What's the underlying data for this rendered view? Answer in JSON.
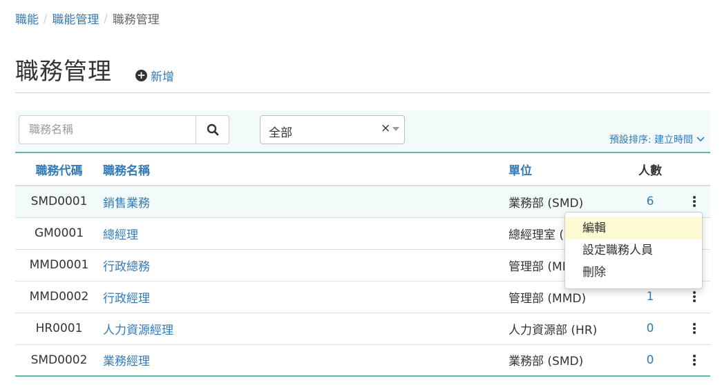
{
  "breadcrumb": {
    "items": [
      "職能",
      "職能管理"
    ],
    "current": "職務管理"
  },
  "page": {
    "title": "職務管理",
    "add_label": "新增"
  },
  "filters": {
    "search_placeholder": "職務名稱",
    "select_value": "全部",
    "sort_label": "預設排序: 建立時間"
  },
  "table": {
    "headers": {
      "code": "職務代碼",
      "name": "職務名稱",
      "unit": "單位",
      "count": "人數"
    },
    "rows": [
      {
        "code": "SMD0001",
        "name": "銷售業務",
        "unit": "業務部 (SMD)",
        "count": "6"
      },
      {
        "code": "GM0001",
        "name": "總經理",
        "unit": "總經理室 (GM)",
        "count": ""
      },
      {
        "code": "MMD0001",
        "name": "行政總務",
        "unit": "管理部 (MMD)",
        "count": ""
      },
      {
        "code": "MMD0002",
        "name": "行政經理",
        "unit": "管理部 (MMD)",
        "count": "1"
      },
      {
        "code": "HR0001",
        "name": "人力資源經理",
        "unit": "人力資源部 (HR)",
        "count": "0"
      },
      {
        "code": "SMD0002",
        "name": "業務經理",
        "unit": "業務部 (SMD)",
        "count": "0"
      }
    ]
  },
  "row_menu": {
    "items": [
      "編輯",
      "設定職務人員",
      "刪除"
    ],
    "active_index": 0
  },
  "colors": {
    "link": "#337ab7",
    "accent_border": "#5cb8a8",
    "filter_bg": "#f2fbfa",
    "menu_active": "#fdfbd4"
  }
}
